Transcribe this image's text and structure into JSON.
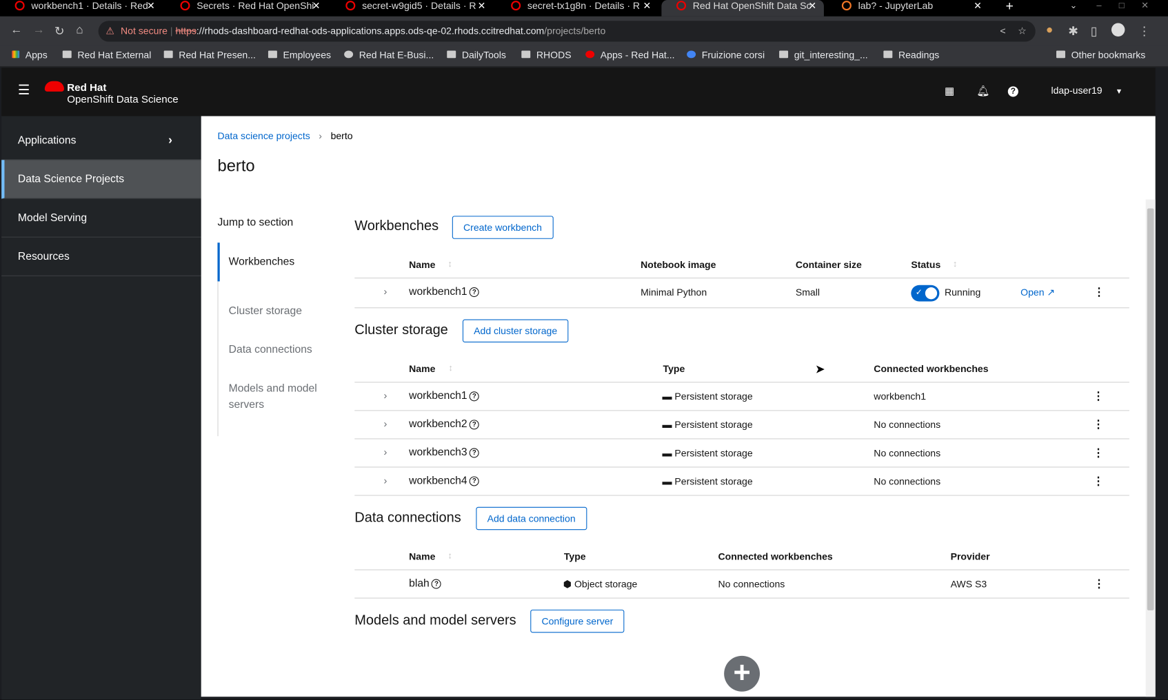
{
  "browser": {
    "tabs": [
      {
        "label": "workbench1 · Details · Red"
      },
      {
        "label": "Secrets · Red Hat OpenShi"
      },
      {
        "label": "secret-w9gid5 · Details · R"
      },
      {
        "label": "secret-tx1g8n · Details · R"
      },
      {
        "label": "Red Hat OpenShift Data Sc"
      },
      {
        "label": "lab? - JupyterLab"
      }
    ],
    "not_secure": "Not secure",
    "url_scheme": "https",
    "url_host": "://rhods-dashboard-redhat-ods-applications.apps.ods-qe-02.rhods.ccitredhat.com",
    "url_path": "/projects/berto",
    "bookmarks": [
      "Apps",
      "Red Hat External",
      "Red Hat Presen...",
      "Employees",
      "Red Hat E-Busi...",
      "DailyTools",
      "RHODS",
      "Apps - Red Hat...",
      "Fruizione corsi",
      "git_interesting_...",
      "Readings"
    ],
    "other_bookmarks": "Other bookmarks"
  },
  "masthead": {
    "brand_top": "Red Hat",
    "brand_bottom": "OpenShift Data Science",
    "user": "ldap-user19"
  },
  "sidebar": {
    "items": [
      {
        "label": "Applications"
      },
      {
        "label": "Data Science Projects"
      },
      {
        "label": "Model Serving"
      },
      {
        "label": "Resources"
      }
    ]
  },
  "breadcrumb": {
    "parent": "Data science projects",
    "current": "berto"
  },
  "page_title": "berto",
  "jump": {
    "title": "Jump to section",
    "links": [
      "Workbenches",
      "Cluster storage",
      "Data connections",
      "Models and model servers"
    ]
  },
  "workbenches": {
    "title": "Workbenches",
    "button": "Create workbench",
    "headers": [
      "Name",
      "Notebook image",
      "Container size",
      "Status"
    ],
    "rows": [
      {
        "name": "workbench1",
        "image": "Minimal Python",
        "size": "Small",
        "status": "Running",
        "open": "Open"
      }
    ]
  },
  "cluster_storage": {
    "title": "Cluster storage",
    "button": "Add cluster storage",
    "headers": [
      "Name",
      "Type",
      "Connected workbenches"
    ],
    "rows": [
      {
        "name": "workbench1",
        "type": "Persistent storage",
        "connected": "workbench1"
      },
      {
        "name": "workbench2",
        "type": "Persistent storage",
        "connected": "No connections"
      },
      {
        "name": "workbench3",
        "type": "Persistent storage",
        "connected": "No connections"
      },
      {
        "name": "workbench4",
        "type": "Persistent storage",
        "connected": "No connections"
      }
    ]
  },
  "data_connections": {
    "title": "Data connections",
    "button": "Add data connection",
    "headers": [
      "Name",
      "Type",
      "Connected workbenches",
      "Provider"
    ],
    "rows": [
      {
        "name": "blah",
        "type": "Object storage",
        "connected": "No connections",
        "provider": "AWS S3"
      }
    ]
  },
  "models": {
    "title": "Models and model servers",
    "button": "Configure server"
  }
}
